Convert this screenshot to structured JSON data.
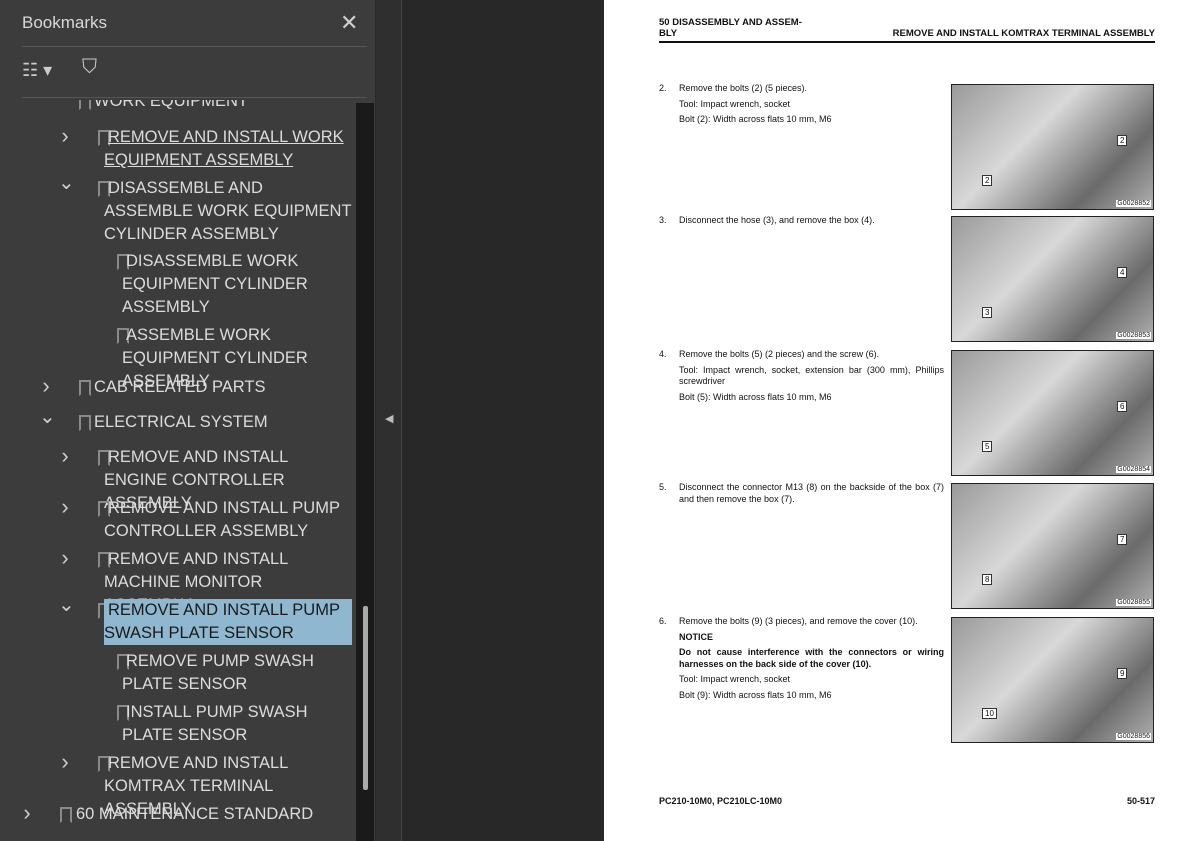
{
  "bookmarks": {
    "title": "Bookmarks",
    "items": [
      {
        "label": "WORK EQUIPMENT",
        "level": 1,
        "chev": "",
        "partial": true
      },
      {
        "label": "REMOVE AND INSTALL WORK EQUIPMENT ASSEMBLY",
        "level": 2,
        "chev": "collapsed",
        "hover": true
      },
      {
        "label": "DISASSEMBLE AND ASSEMBLE WORK EQUIPMENT CYLINDER ASSEMBLY",
        "level": 2,
        "chev": "expanded"
      },
      {
        "label": "DISASSEMBLE WORK EQUIPMENT CYLINDER ASSEMBLY",
        "level": 3,
        "chev": ""
      },
      {
        "label": "ASSEMBLE WORK EQUIPMENT CYLINDER ASSEMBLY",
        "level": 3,
        "chev": ""
      },
      {
        "label": "CAB RELATED PARTS",
        "level": 1,
        "chev": "collapsed"
      },
      {
        "label": "ELECTRICAL SYSTEM",
        "level": 1,
        "chev": "expanded"
      },
      {
        "label": "REMOVE AND INSTALL ENGINE CONTROLLER ASSEMBLY",
        "level": 2,
        "chev": "collapsed"
      },
      {
        "label": "REMOVE AND INSTALL PUMP CONTROLLER ASSEMBLY",
        "level": 2,
        "chev": "collapsed"
      },
      {
        "label": "REMOVE AND INSTALL MACHINE MONITOR ASSEMBLY",
        "level": 2,
        "chev": "collapsed"
      },
      {
        "label": "REMOVE AND INSTALL PUMP SWASH PLATE SENSOR",
        "level": 2,
        "chev": "expanded",
        "selected": true
      },
      {
        "label": "REMOVE PUMP SWASH PLATE SENSOR",
        "level": 3,
        "chev": ""
      },
      {
        "label": "INSTALL PUMP SWASH PLATE SENSOR",
        "level": 3,
        "chev": ""
      },
      {
        "label": "REMOVE AND INSTALL KOMTRAX TERMINAL ASSEMBLY",
        "level": 2,
        "chev": "collapsed"
      },
      {
        "label": "60 MAINTENANCE STANDARD",
        "level": 0,
        "chev": "collapsed"
      }
    ]
  },
  "page": {
    "header_left": "50 DISASSEMBLY AND ASSEM-\nBLY",
    "header_right": "REMOVE AND INSTALL KOMTRAX TERMINAL ASSEMBLY",
    "steps": [
      {
        "num": "2.",
        "lines": [
          "Remove the bolts (2) (5 pieces).",
          "Tool: Impact wrench, socket",
          "Bolt (2): Width across flats 10 mm, M6"
        ],
        "figure": "G0028852",
        "callouts": [
          "2",
          "2"
        ]
      },
      {
        "num": "3.",
        "lines": [
          "Disconnect the hose (3), and remove the box (4)."
        ],
        "figure": "G0028853",
        "callouts": [
          "4",
          "3"
        ]
      },
      {
        "num": "4.",
        "lines": [
          "Remove the bolts (5) (2 pieces) and the screw (6).",
          "Tool: Impact wrench, socket, extension bar (300 mm), Phillips screwdriver",
          "Bolt (5): Width across flats 10 mm, M6"
        ],
        "figure": "G0028854",
        "callouts": [
          "6",
          "5"
        ]
      },
      {
        "num": "5.",
        "lines": [
          "Disconnect the connector M13 (8) on the backside of the box (7) and then remove the box (7)."
        ],
        "figure": "G0028855",
        "callouts": [
          "7",
          "8"
        ]
      },
      {
        "num": "6.",
        "lines": [
          "Remove the bolts (9) (3 pieces), and remove the cover (10).",
          "NOTICE",
          "Do not cause interference with the connectors or wiring harnesses on the back side of the cover (10).",
          "Tool: Impact wrench, socket",
          "Bolt (9): Width across flats 10 mm, M6"
        ],
        "figure": "G0028856",
        "callouts": [
          "9",
          "10"
        ]
      }
    ],
    "footer_model": "PC210-10M0, PC210LC-10M0",
    "footer_page": "50-517"
  }
}
